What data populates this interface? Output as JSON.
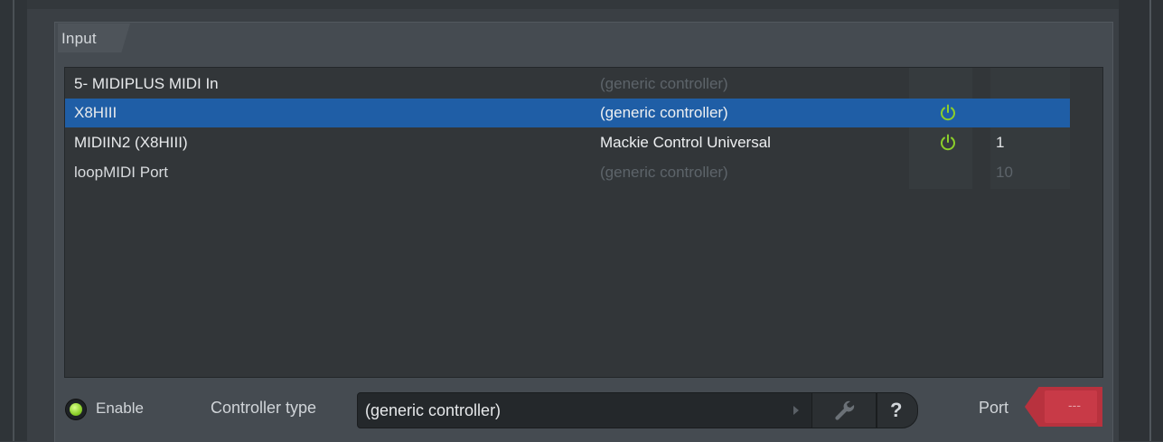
{
  "panel": {
    "title": "Input"
  },
  "devices": [
    {
      "name": "5- MIDIPLUS MIDI In",
      "controller": "(generic controller)",
      "controller_state": "dim",
      "enabled": false,
      "port": ""
    },
    {
      "name": "X8HIII",
      "controller": "(generic controller)",
      "controller_state": "bright",
      "enabled": true,
      "port": "",
      "selected": true
    },
    {
      "name": "MIDIIN2 (X8HIII)",
      "controller": "Mackie Control Universal",
      "controller_state": "bright",
      "enabled": true,
      "port": "1"
    },
    {
      "name": "loopMIDI Port",
      "controller": "(generic controller)",
      "controller_state": "dim",
      "enabled": false,
      "port": "10"
    }
  ],
  "footer": {
    "enable_label": "Enable",
    "enable_on": true,
    "controller_type_label": "Controller type",
    "controller_type_value": "(generic controller)",
    "help_label": "?",
    "port_label": "Port",
    "port_value": "---"
  },
  "colors": {
    "selection": "#1f5ea6",
    "power_on": "#8ccf2a",
    "port_box": "#c83a47",
    "panel_bg": "#454b51",
    "list_bg": "#323639"
  },
  "icons": {
    "power": "power-icon",
    "wrench": "wrench-icon",
    "arrow": "chevron-right-icon",
    "led": "led-icon"
  }
}
